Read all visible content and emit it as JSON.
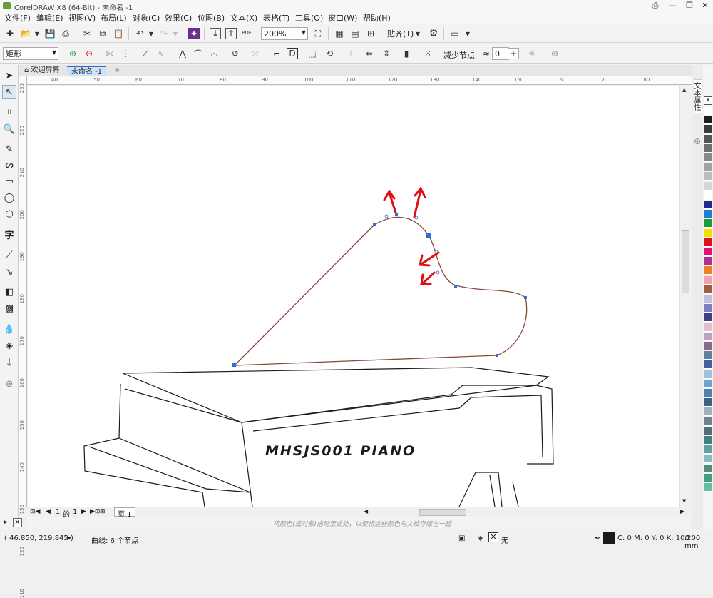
{
  "window": {
    "title": "CorelDRAW X8 (64-Bit) - 未命名 -1"
  },
  "menu": [
    "文件(F)",
    "编辑(E)",
    "视图(V)",
    "布局(L)",
    "对象(C)",
    "效果(C)",
    "位图(B)",
    "文本(X)",
    "表格(T)",
    "工具(O)",
    "窗口(W)",
    "帮助(H)"
  ],
  "toolbar": {
    "zoom": "200%",
    "snap_label": "贴齐(T)",
    "pdf_label": "PDF"
  },
  "propertybar": {
    "shape_select": "矩形",
    "reduce_nodes": "减少节点",
    "smoothness": "0"
  },
  "doc_tabs": [
    "欢迎屏幕",
    "未命名 -1"
  ],
  "ruler": {
    "h_ticks": [
      "40",
      "50",
      "60",
      "70",
      "80",
      "90",
      "100",
      "110",
      "120",
      "130",
      "140",
      "150",
      "160",
      "170",
      "180"
    ],
    "v_ticks": [
      "230",
      "220",
      "210",
      "200",
      "190",
      "180",
      "170",
      "160",
      "150",
      "140",
      "130",
      "120",
      "110"
    ]
  },
  "docker": {
    "tab_label": "文本属性"
  },
  "pages": {
    "current": "1",
    "of_label": "的",
    "total": "1",
    "page_tab": "页 1"
  },
  "color_hint": "将颜色(或对象)拖动至此处，以便将这些颜色与文档存储在一起",
  "drawing": {
    "piano_text": "MHSJS001 PIANO"
  },
  "status": {
    "coords": "( 46.850, 219.845 )",
    "object_info": "曲线: 6 个节点",
    "fill_none": "无",
    "color_info": "C: 0 M: 0 Y: 0 K: 100",
    "outline_width": ".200 mm"
  },
  "colors": {
    "accent": "#2f6fd0",
    "outline": "#1a1a1a",
    "arrows": "#e01010",
    "palette": [
      "#ffffff",
      "#1d1d1d",
      "#3a3a3a",
      "#555555",
      "#6e6e6e",
      "#888888",
      "#a2a2a2",
      "#bcbcbc",
      "#d6d6d6",
      "#ffffff",
      "#1f2a8a",
      "#1d7fc8",
      "#1a9a3c",
      "#f2e000",
      "#e0101e",
      "#e0107a",
      "#b03090",
      "#f08020",
      "#f4a0b0",
      "#a06040",
      "#c0c0e0",
      "#8080c0",
      "#404080",
      "#e0c0d0",
      "#c0a0c0",
      "#8a6a8a",
      "#6080a0",
      "#4060a0",
      "#a0c0e0",
      "#70a0d0",
      "#5080b0",
      "#406080",
      "#a0b0c0",
      "#708090",
      "#507070",
      "#408080",
      "#60a0a0",
      "#80c0c0",
      "#509070",
      "#40a080",
      "#60c0a0"
    ]
  }
}
